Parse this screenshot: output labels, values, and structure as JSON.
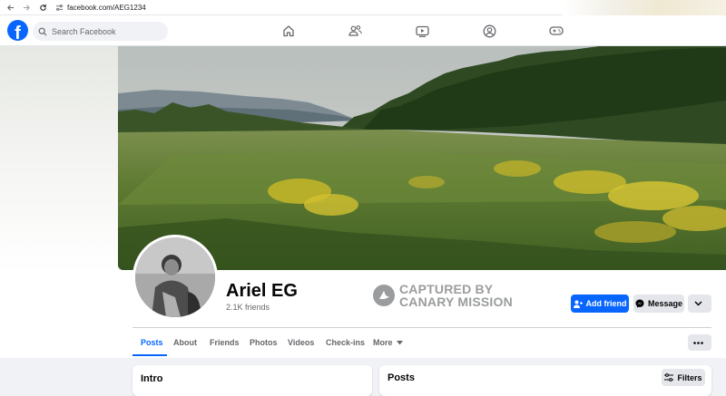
{
  "browser": {
    "url": "facebook.com/AEG1234"
  },
  "header": {
    "logo": "f",
    "search_placeholder": "Search Facebook",
    "nav_icons": [
      "home-icon",
      "friends-icon",
      "watch-icon",
      "groups-icon",
      "gaming-icon"
    ]
  },
  "profile": {
    "name": "Ariel EG",
    "friends": "2.1K friends",
    "watermark_line1": "CAPTURED BY",
    "watermark_line2": "CANARY MISSION"
  },
  "actions": {
    "add_friend": "Add friend",
    "message": "Message"
  },
  "tabs": [
    {
      "label": "Posts",
      "active": true
    },
    {
      "label": "About",
      "active": false
    },
    {
      "label": "Friends",
      "active": false
    },
    {
      "label": "Photos",
      "active": false
    },
    {
      "label": "Videos",
      "active": false
    },
    {
      "label": "Check-ins",
      "active": false
    },
    {
      "label": "More",
      "active": false
    }
  ],
  "intro": {
    "title": "Intro"
  },
  "posts": {
    "title": "Posts",
    "filters": "Filters"
  },
  "colors": {
    "accent": "#0866ff",
    "background": "#f0f2f5",
    "secondary_button": "#e4e6eb"
  }
}
